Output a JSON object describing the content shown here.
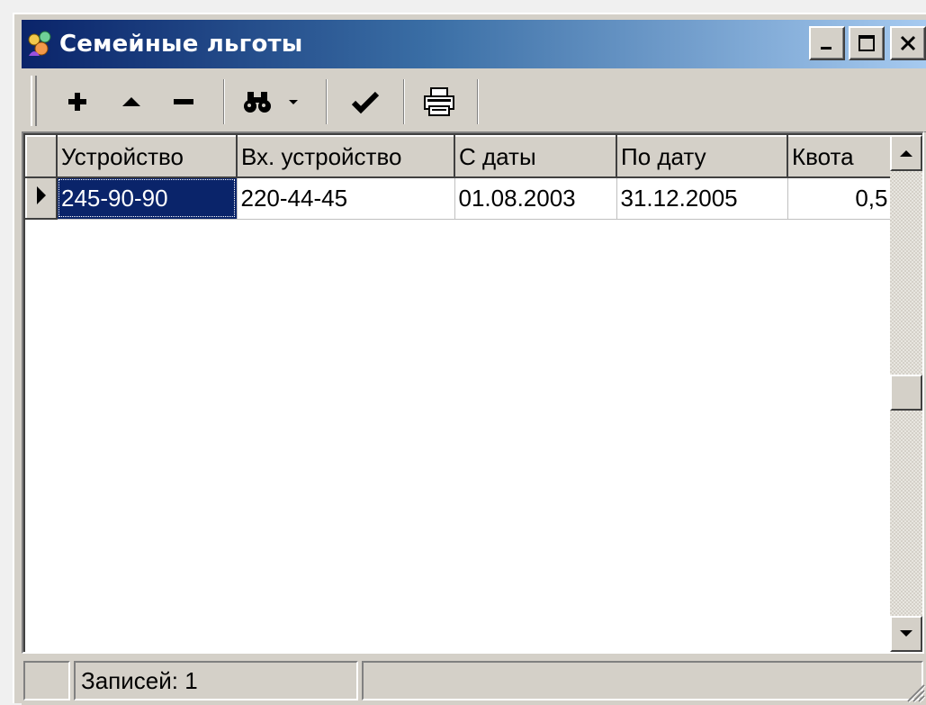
{
  "window": {
    "title": "Семейные льготы",
    "title_icon": "family-people-icon",
    "controls": [
      "minimize-icon",
      "maximize-icon",
      "close-icon"
    ]
  },
  "toolbar": {
    "buttons": [
      {
        "icon": "plus-icon",
        "action": "add"
      },
      {
        "icon": "triangle-up-icon",
        "action": "edit"
      },
      {
        "icon": "minus-icon",
        "action": "delete"
      },
      {
        "icon": "binoculars-icon",
        "action": "find",
        "has_dropdown": true
      },
      {
        "icon": "checkmark-icon",
        "action": "apply"
      },
      {
        "icon": "printer-icon",
        "action": "print"
      }
    ]
  },
  "grid": {
    "columns": [
      "Устройство",
      "Вх. устройство",
      "С даты",
      "По дату",
      "Квота"
    ],
    "rows": [
      {
        "device": "245-90-90",
        "in_device": "220-44-45",
        "from_date": "01.08.2003",
        "to_date": "31.12.2005",
        "quota": "0,5"
      }
    ],
    "current_row_indicator": "row-pointer-icon"
  },
  "status": {
    "records": "Записей: 1"
  },
  "colors": {
    "title_start": "#0a246a",
    "title_end": "#a6caf0",
    "face": "#d4d0c8",
    "selection": "#0a246a"
  }
}
